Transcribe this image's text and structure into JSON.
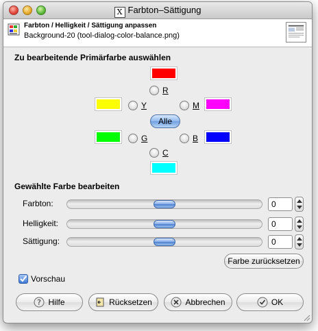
{
  "window": {
    "title": "Farbton–Sättigung",
    "title_glyph": "X"
  },
  "header": {
    "title": "Farbton / Helligkeit / Sättigung anpassen",
    "subtitle": "Background-20 (tool-dialog-color-balance.png)"
  },
  "primary_section": {
    "title": "Zu bearbeitende Primärfarbe auswählen",
    "options": [
      {
        "key": "R",
        "label": "R",
        "color": "#ff0000"
      },
      {
        "key": "Y",
        "label": "Y",
        "color": "#ffff00"
      },
      {
        "key": "M",
        "label": "M",
        "color": "#ff00ff"
      },
      {
        "key": "G",
        "label": "G",
        "color": "#00ff00"
      },
      {
        "key": "B",
        "label": "B",
        "color": "#0000ff"
      },
      {
        "key": "C",
        "label": "C",
        "color": "#00ffff"
      }
    ],
    "all_label": "Alle",
    "selected": "Alle"
  },
  "edit_section": {
    "title": "Gewählte Farbe bearbeiten",
    "sliders": [
      {
        "label": "Farbton:",
        "value": "0",
        "fraction": 0.5
      },
      {
        "label": "Helligkeit:",
        "value": "0",
        "fraction": 0.5
      },
      {
        "label": "Sättigung:",
        "value": "0",
        "fraction": 0.5
      }
    ],
    "reset_color_label": "Farbe zurücksetzen"
  },
  "preview": {
    "label": "Vorschau",
    "checked": true
  },
  "buttons": {
    "help": "Hilfe",
    "reset": "Rücksetzen",
    "cancel": "Abbrechen",
    "ok": "OK"
  },
  "colors": {
    "accent": "#4c7fd0"
  }
}
